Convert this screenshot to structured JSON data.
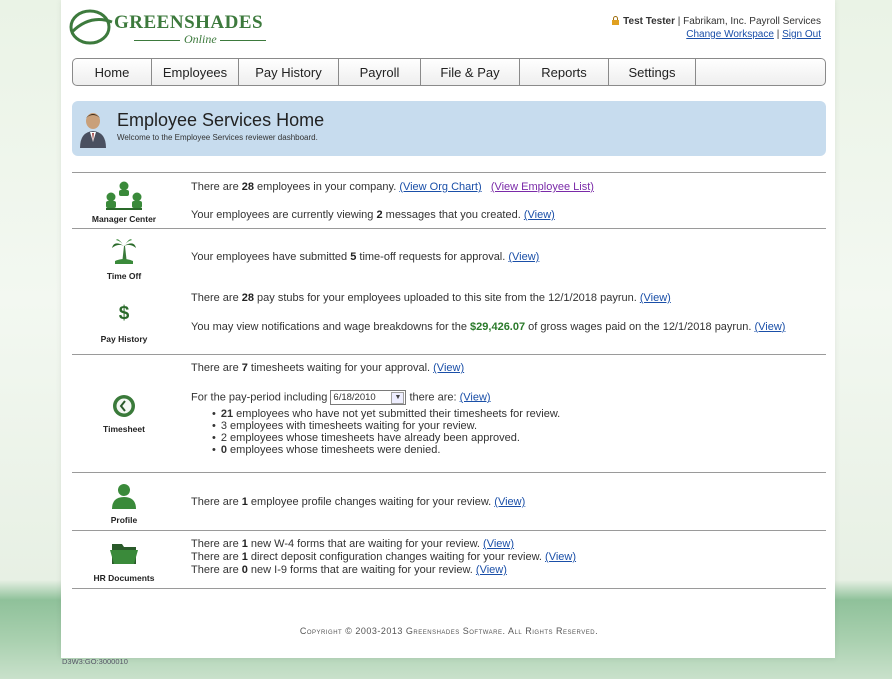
{
  "header": {
    "brand": "GREENSHADES",
    "brand_sub": "Online",
    "user_name": "Test Tester",
    "company": " | Fabrikam, Inc. Payroll Services",
    "change_workspace": "Change Workspace",
    "separator": " | ",
    "sign_out": "Sign Out"
  },
  "nav": {
    "items": [
      "Home",
      "Employees",
      "Pay History",
      "Payroll",
      "File & Pay",
      "Reports",
      "Settings",
      ""
    ]
  },
  "page": {
    "title": "Employee Services Home",
    "subtitle": "Welcome to the Employee Services reviewer dashboard."
  },
  "sections": {
    "manager": {
      "label": "Manager Center",
      "line1_a": "There are ",
      "line1_count": "28",
      "line1_b": " employees in your company.  ",
      "org_chart": "(View Org Chart)",
      "employee_list": "(View Employee List)",
      "line2_a": "Your employees are currently viewing ",
      "line2_count": "2",
      "line2_b": " messages that you created. ",
      "view": "(View)"
    },
    "timeoff": {
      "label": "Time Off",
      "line_a": "Your employees have submitted ",
      "line_count": "5",
      "line_b": " time-off requests for approval. ",
      "view": "(View)"
    },
    "payhistory": {
      "label": "Pay History",
      "line1_a": "There are ",
      "line1_count": "28",
      "line1_b": " pay stubs for your employees uploaded to this site from the 12/1/2018 payrun. ",
      "line2_a": "You may view notifications and wage breakdowns for the ",
      "line2_amount": "$29,426.07",
      "line2_b": " of gross wages paid on the 12/1/2018 payrun.",
      "view": "(View)"
    },
    "timesheet": {
      "label": "Timesheet",
      "line1_a": "There are ",
      "line1_count": "7",
      "line1_b": " timesheets waiting for your approval. ",
      "period_a": "For the pay-period including ",
      "period_date": "6/18/2010",
      "period_b": "  there are:  ",
      "view": "(View)",
      "b1_count": "21",
      "b1_text": " employees who have not yet submitted their timesheets for review.",
      "b2_count": "3",
      "b2_text": " employees with timesheets waiting for your review.",
      "b3_count": "2",
      "b3_text": " employees whose timesheets have already been approved.",
      "b4_count": "0",
      "b4_text": " employees whose timesheets were denied."
    },
    "profile": {
      "label": "Profile",
      "line_a": "There are ",
      "line_count": "1",
      "line_b": " employee profile changes waiting for your review. ",
      "view": "(View)"
    },
    "hrdocs": {
      "label": "HR Documents",
      "l1_a": "There are ",
      "l1_count": "1",
      "l1_b": " new W-4 forms that are waiting for your review. ",
      "l2_a": "There are ",
      "l2_count": "1",
      "l2_b": " direct deposit configuration changes waiting for your review. ",
      "l3_a": "There are ",
      "l3_count": "0",
      "l3_b": " new I-9 forms that are waiting for your review. ",
      "view": "(View)"
    }
  },
  "footer": {
    "copyright": "Copyright © 2003-2013 Greenshades Software. All Rights Reserved.",
    "code": "D3W3:GO:3000010"
  },
  "icons": {
    "logo": "greenshades-logo-icon",
    "lock": "lock-icon",
    "user": "user-avatar-icon",
    "manager": "people-org-icon",
    "timeoff": "palm-tree-icon",
    "payhistory": "dollar-icon",
    "timesheet": "clock-icon",
    "profile": "person-icon",
    "hrdocs": "folder-icon"
  },
  "colors": {
    "accent_green": "#3d7a3d",
    "link_blue": "#1a4fa8",
    "title_panel": "#c7dcee"
  }
}
